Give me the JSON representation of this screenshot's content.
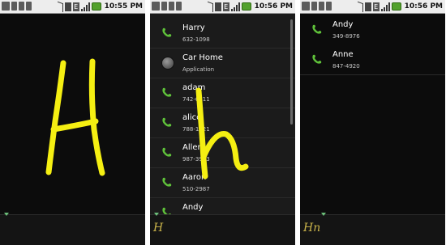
{
  "status_time": [
    "10:55 PM",
    "10:56 PM",
    "10:56 PM"
  ],
  "panel2": {
    "contacts": [
      {
        "name": "Harry",
        "number": "632-1098",
        "type": "phone"
      },
      {
        "name": "Car Home",
        "number": "Application",
        "type": "app"
      },
      {
        "name": "adam",
        "number": "742-6811",
        "type": "phone"
      },
      {
        "name": "alice",
        "number": "788-1221",
        "type": "phone"
      },
      {
        "name": "Allen",
        "number": "987-3923",
        "type": "phone"
      },
      {
        "name": "Aaron",
        "number": "510-2987",
        "type": "phone"
      },
      {
        "name": "Andy",
        "number": "",
        "type": "phone"
      }
    ],
    "filter_text": "H"
  },
  "panel3": {
    "contacts": [
      {
        "name": "Andy",
        "number": "349-8976",
        "type": "phone"
      },
      {
        "name": "Anne",
        "number": "847-4920",
        "type": "phone"
      }
    ],
    "filter_text": "Hn"
  },
  "colors": {
    "ink": "#f5ef12",
    "phone_icon": "#5fc13a"
  }
}
